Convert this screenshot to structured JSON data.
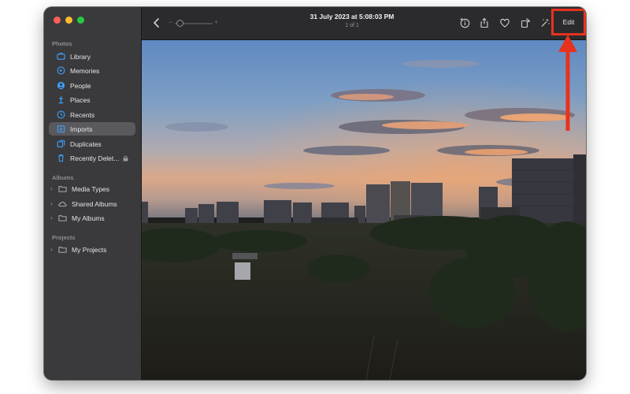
{
  "window": {
    "controls": [
      "close",
      "minimize",
      "maximize"
    ]
  },
  "sidebar": {
    "sections": {
      "photos": "Photos",
      "albums": "Albums",
      "projects": "Projects"
    },
    "items": [
      {
        "label": "Library",
        "icon": "library-icon"
      },
      {
        "label": "Memories",
        "icon": "memories-icon"
      },
      {
        "label": "People",
        "icon": "people-icon"
      },
      {
        "label": "Places",
        "icon": "places-icon"
      },
      {
        "label": "Recents",
        "icon": "recents-icon"
      },
      {
        "label": "Imports",
        "icon": "imports-icon",
        "active": true
      },
      {
        "label": "Duplicates",
        "icon": "duplicates-icon"
      },
      {
        "label": "Recently Delet...",
        "icon": "trash-icon"
      }
    ],
    "albums": [
      {
        "label": "Media Types"
      },
      {
        "label": "Shared Albums"
      },
      {
        "label": "My Albums"
      }
    ],
    "projects": [
      {
        "label": "My Projects"
      }
    ]
  },
  "toolbar": {
    "title": "31 July 2023 at 5:08:03 PM",
    "subtitle": "1 of 1",
    "zoom_minus": "−",
    "zoom_plus": "+",
    "edit_label": "Edit"
  },
  "colors": {
    "accent": "#3ea0ff",
    "annotation": "#e8321e"
  }
}
